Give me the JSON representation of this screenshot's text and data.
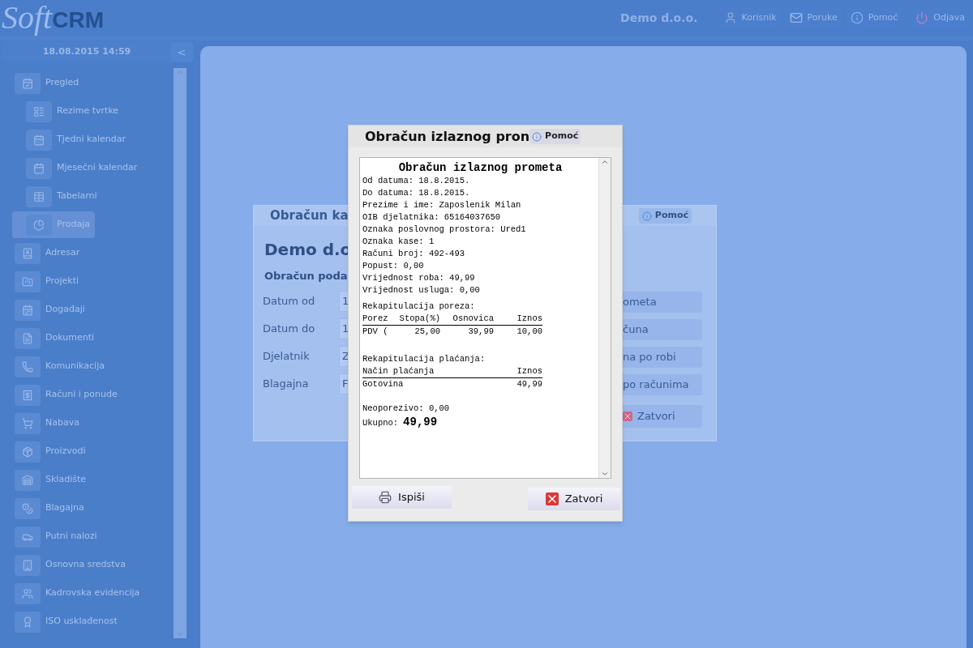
{
  "header": {
    "logo": {
      "script": "Soft",
      "bold": "CRM"
    },
    "company": "Demo d.o.o.",
    "actions": [
      {
        "label": "Korisnik"
      },
      {
        "label": "Poruke"
      },
      {
        "label": "Pomoć"
      },
      {
        "label": "Odjava"
      }
    ]
  },
  "sidebar": {
    "datetime": "18.08.2015 14:59",
    "collapse_button": "<",
    "menu": [
      {
        "label": "Pregled",
        "selected": false,
        "children": [
          {
            "label": "Rezime tvrtke",
            "selected": false
          },
          {
            "label": "Tjedni kalendar",
            "selected": false
          },
          {
            "label": "Mjesečni kalendar",
            "selected": false
          },
          {
            "label": "Tabelarni",
            "selected": false
          },
          {
            "label": "Prodaja",
            "selected": true
          }
        ]
      },
      {
        "label": "Adresar",
        "selected": false
      },
      {
        "label": "Projekti",
        "selected": false
      },
      {
        "label": "Događaji",
        "selected": false
      },
      {
        "label": "Dokumenti",
        "selected": false
      },
      {
        "label": "Komunikacija",
        "selected": false
      },
      {
        "label": "Računi i ponude",
        "selected": false
      },
      {
        "label": "Nabava",
        "selected": false
      },
      {
        "label": "Proizvodi",
        "selected": false
      },
      {
        "label": "Skladište",
        "selected": false
      },
      {
        "label": "Blagajna",
        "selected": false
      },
      {
        "label": "Putni nalozi",
        "selected": false
      },
      {
        "label": "Osnovna sredstva",
        "selected": false
      },
      {
        "label": "Kadrovska evidencija",
        "selected": false
      },
      {
        "label": "ISO usklađenost",
        "selected": false
      }
    ]
  },
  "back_dialog": {
    "title": "Obračun ka",
    "help": "Pomoć",
    "company": "Demo d.o",
    "subtitle": "Obračun poda",
    "fields": [
      {
        "label": "Datum od",
        "value": "1"
      },
      {
        "label": "Datum do",
        "value": "1"
      },
      {
        "label": "Djelatnik",
        "value": "Z"
      },
      {
        "label": "Blagajna",
        "value": "F"
      }
    ],
    "buttons": [
      {
        "label": "ometa",
        "kind": "plain"
      },
      {
        "label": "čuna",
        "kind": "plain"
      },
      {
        "label": "na po robi",
        "kind": "plain"
      },
      {
        "label": "po računima",
        "kind": "plain"
      },
      {
        "label": "Zatvori",
        "kind": "close"
      }
    ]
  },
  "dialog": {
    "title": "Obračun izlaznog pron",
    "help": "Pomoć",
    "receipt": {
      "title": "Obračun izlaznog prometa",
      "lines": [
        "Od datuma: 18.8.2015.",
        "Do datuma: 18.8.2015.",
        "Prezime i ime: Zaposlenik Milan",
        "OIB djelatnika: 65164037650",
        "Oznaka poslovnog prostora: Ured1",
        "Oznaka kase: 1",
        "Računi broj: 492-493",
        "Popust: 0,00",
        "Vrijednost roba: 49,99",
        "Vrijednost usluga: 0,00"
      ],
      "tax_heading": "Rekapitulacija poreza:",
      "tax_columns": [
        "Porez",
        "Stopa(%)",
        "Osnovica",
        "Iznos"
      ],
      "tax_rows": [
        [
          "PDV (",
          "25,00",
          "39,99",
          "10,00"
        ]
      ],
      "payment_heading": "Rekapitulacija plaćanja:",
      "payment_columns": [
        "Način plaćanja",
        "Iznos"
      ],
      "payment_rows": [
        [
          "Gotovina",
          "49,99"
        ]
      ],
      "untaxed": "Neoporezivo: 0,00",
      "total_label": "Ukupno:",
      "total_value": "49,99"
    },
    "buttons": [
      {
        "label": "Ispiši",
        "kind": "print"
      },
      {
        "label": "Zatvori",
        "kind": "close"
      }
    ]
  }
}
